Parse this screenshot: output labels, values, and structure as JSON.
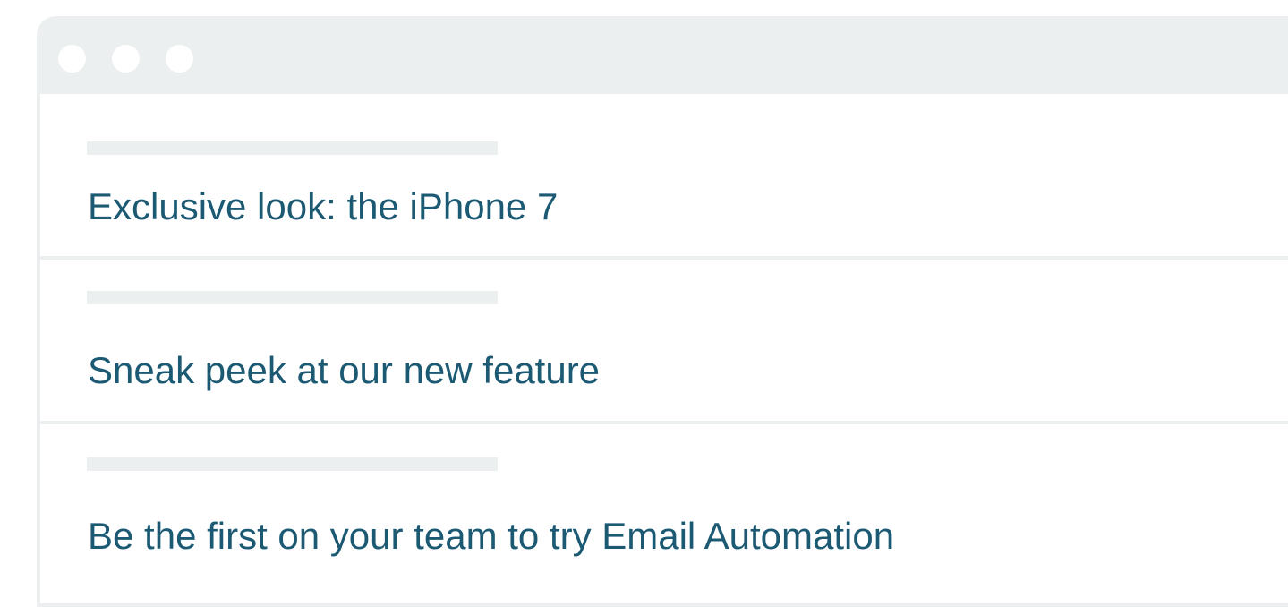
{
  "window": {
    "controls": [
      "close",
      "minimize",
      "maximize"
    ]
  },
  "emails": [
    {
      "subject": "Exclusive look: the iPhone 7"
    },
    {
      "subject": "Sneak peek at our new feature"
    },
    {
      "subject": "Be the first on your team to try Email Automation"
    }
  ],
  "colors": {
    "subject_text": "#1c5a74",
    "chrome": "#ecefef",
    "background": "#ffffff"
  }
}
